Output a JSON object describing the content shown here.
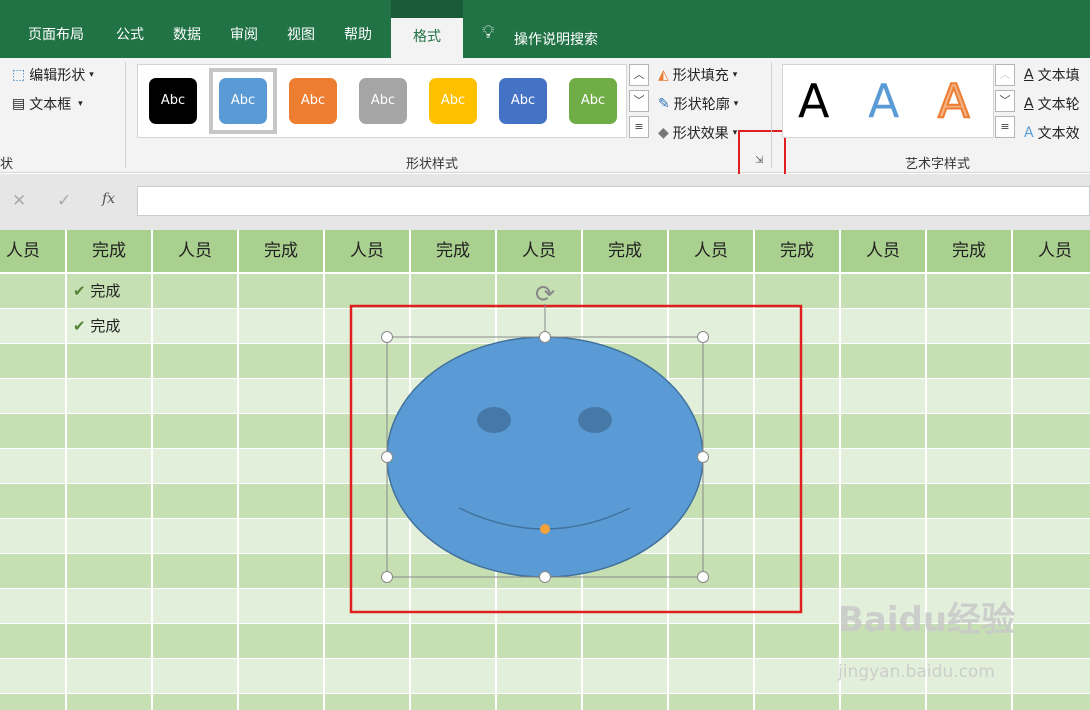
{
  "ribbon_tabs": [
    "页面布局",
    "公式",
    "数据",
    "审阅",
    "视图",
    "帮助"
  ],
  "active_tab": "格式",
  "tell_me": "操作说明搜索",
  "insert_shapes": {
    "edit_shape": "编辑形状",
    "text_box": "文本框",
    "group_label": "状"
  },
  "shape_styles": {
    "swatches": [
      {
        "label": "Abc",
        "color": "#000000"
      },
      {
        "label": "Abc",
        "color": "#5b9bd5"
      },
      {
        "label": "Abc",
        "color": "#ed7d31"
      },
      {
        "label": "Abc",
        "color": "#a5a5a5"
      },
      {
        "label": "Abc",
        "color": "#ffc000"
      },
      {
        "label": "Abc",
        "color": "#4472c4"
      },
      {
        "label": "Abc",
        "color": "#70ad47"
      }
    ],
    "fill": "形状填充",
    "outline": "形状轮廓",
    "effects": "形状效果",
    "group_label": "形状样式"
  },
  "wordart": {
    "letters": [
      "A",
      "A",
      "A"
    ],
    "text_fill": "文本填",
    "text_outline": "文本轮",
    "text_effects": "文本效",
    "group_label": "艺术字样式"
  },
  "formula_bar": {
    "cancel": "✕",
    "enter": "✓",
    "fx": "fx",
    "value": ""
  },
  "grid": {
    "headers": [
      "人员",
      "完成",
      "人员",
      "完成",
      "人员",
      "完成",
      "人员",
      "完成",
      "人员",
      "完成",
      "人员",
      "完成",
      "人员"
    ],
    "done_rows": [
      "完成",
      "完成"
    ]
  },
  "watermark": {
    "brand": "Baidu经验",
    "url": "jingyan.baidu.com"
  },
  "colors": {
    "header": "#a9d08e",
    "row_a": "#c6e0b4",
    "row_b": "#e2efda",
    "highlight": "#e02020",
    "smiley": "#5b9bd5"
  }
}
